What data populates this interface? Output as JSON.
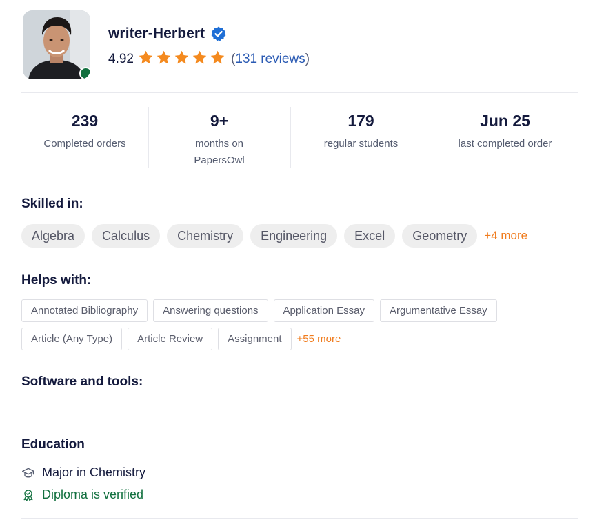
{
  "profile": {
    "name": "writer-Herbert",
    "rating": "4.92",
    "stars": 5,
    "reviews_count": "131 reviews",
    "online": true
  },
  "stats": [
    {
      "value": "239",
      "label": "Completed orders"
    },
    {
      "value": "9+",
      "label": "months on PapersOwl"
    },
    {
      "value": "179",
      "label": "regular students"
    },
    {
      "value": "Jun 25",
      "label": "last completed order"
    }
  ],
  "skills": {
    "title": "Skilled in:",
    "items": [
      "Algebra",
      "Calculus",
      "Chemistry",
      "Engineering",
      "Excel",
      "Geometry"
    ],
    "more": "+4 more"
  },
  "helps": {
    "title": "Helps with:",
    "row1": [
      "Annotated Bibliography",
      "Answering questions",
      "Application Essay",
      "Argumentative Essay"
    ],
    "row2": [
      "Article (Any Type)",
      "Article Review",
      "Assignment"
    ],
    "more": "+55 more"
  },
  "software": {
    "title": "Software and tools:"
  },
  "education": {
    "title": "Education",
    "major": "Major in Chemistry",
    "verified": "Diploma is verified"
  },
  "colors": {
    "accent_orange": "#f07c1e",
    "star": "#f48a1f",
    "verified_blue": "#1f6fd6",
    "link_blue": "#2a5ab3",
    "online_green": "#12703f",
    "text_dark": "#141a3d"
  },
  "icons": {
    "verified": "verified-badge-icon",
    "star": "star-icon",
    "major": "graduation-cap-icon",
    "diploma": "certificate-badge-icon"
  }
}
